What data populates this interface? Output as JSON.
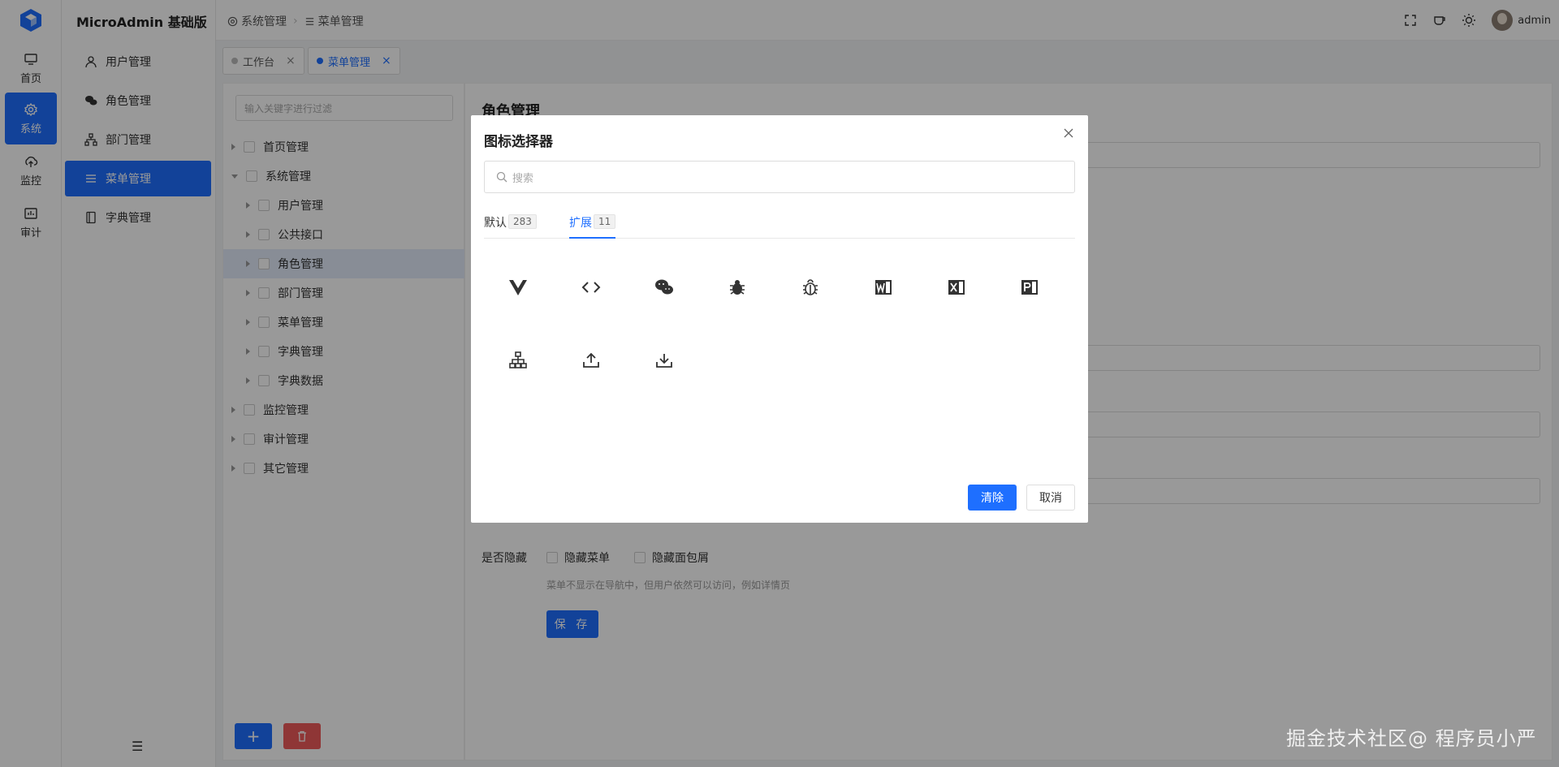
{
  "rail": {
    "items": [
      {
        "label": "首页",
        "icon": "monitor-icon"
      },
      {
        "label": "系统",
        "icon": "gear-icon"
      },
      {
        "label": "监控",
        "icon": "cloud-upload-icon"
      },
      {
        "label": "审计",
        "icon": "chart-icon"
      }
    ]
  },
  "submenu": {
    "app_title": "MicroAdmin 基础版",
    "items": [
      {
        "label": "用户管理",
        "icon": "user-icon"
      },
      {
        "label": "角色管理",
        "icon": "wechat-icon"
      },
      {
        "label": "部门管理",
        "icon": "org-icon"
      },
      {
        "label": "菜单管理",
        "icon": "menu-icon"
      },
      {
        "label": "字典管理",
        "icon": "book-icon"
      }
    ]
  },
  "header": {
    "breadcrumb": [
      "系统管理",
      "菜单管理"
    ],
    "user": "admin"
  },
  "tabs": [
    {
      "label": "工作台",
      "close": "×"
    },
    {
      "label": "菜单管理",
      "close": "×"
    }
  ],
  "tree": {
    "filter_placeholder": "输入关键字进行过滤",
    "rows": [
      {
        "label": "首页管理"
      },
      {
        "label": "系统管理"
      },
      {
        "label": "用户管理"
      },
      {
        "label": "公共接口"
      },
      {
        "label": "角色管理"
      },
      {
        "label": "部门管理"
      },
      {
        "label": "菜单管理"
      },
      {
        "label": "字典管理"
      },
      {
        "label": "字典数据"
      },
      {
        "label": "监控管理"
      },
      {
        "label": "审计管理"
      },
      {
        "label": "其它管理"
      }
    ],
    "add_label": "+"
  },
  "form": {
    "title": "角色管理",
    "hidden_label": "是否隐藏",
    "hide_menu": "隐藏菜单",
    "hide_breadcrumb": "隐藏面包屑",
    "hint": "菜单不显示在导航中，但用户依然可以访问，例如详情页",
    "save_label": "保 存"
  },
  "modal": {
    "title": "图标选择器",
    "search_placeholder": "搜索",
    "tabs": [
      {
        "label": "默认",
        "count": "283"
      },
      {
        "label": "扩展",
        "count": "11"
      }
    ],
    "icons": [
      "vue-icon",
      "code-icon",
      "wechat-icon",
      "bug-filled-icon",
      "bug-outline-icon",
      "word-icon",
      "excel-icon",
      "powerpoint-icon",
      "org-chart-icon",
      "upload-icon",
      "download-icon"
    ],
    "clear_label": "清除",
    "cancel_label": "取消"
  },
  "watermark": "掘金技术社区@ 程序员小严",
  "colors": {
    "primary": "#1e6fff",
    "danger": "#ef5b5b"
  }
}
